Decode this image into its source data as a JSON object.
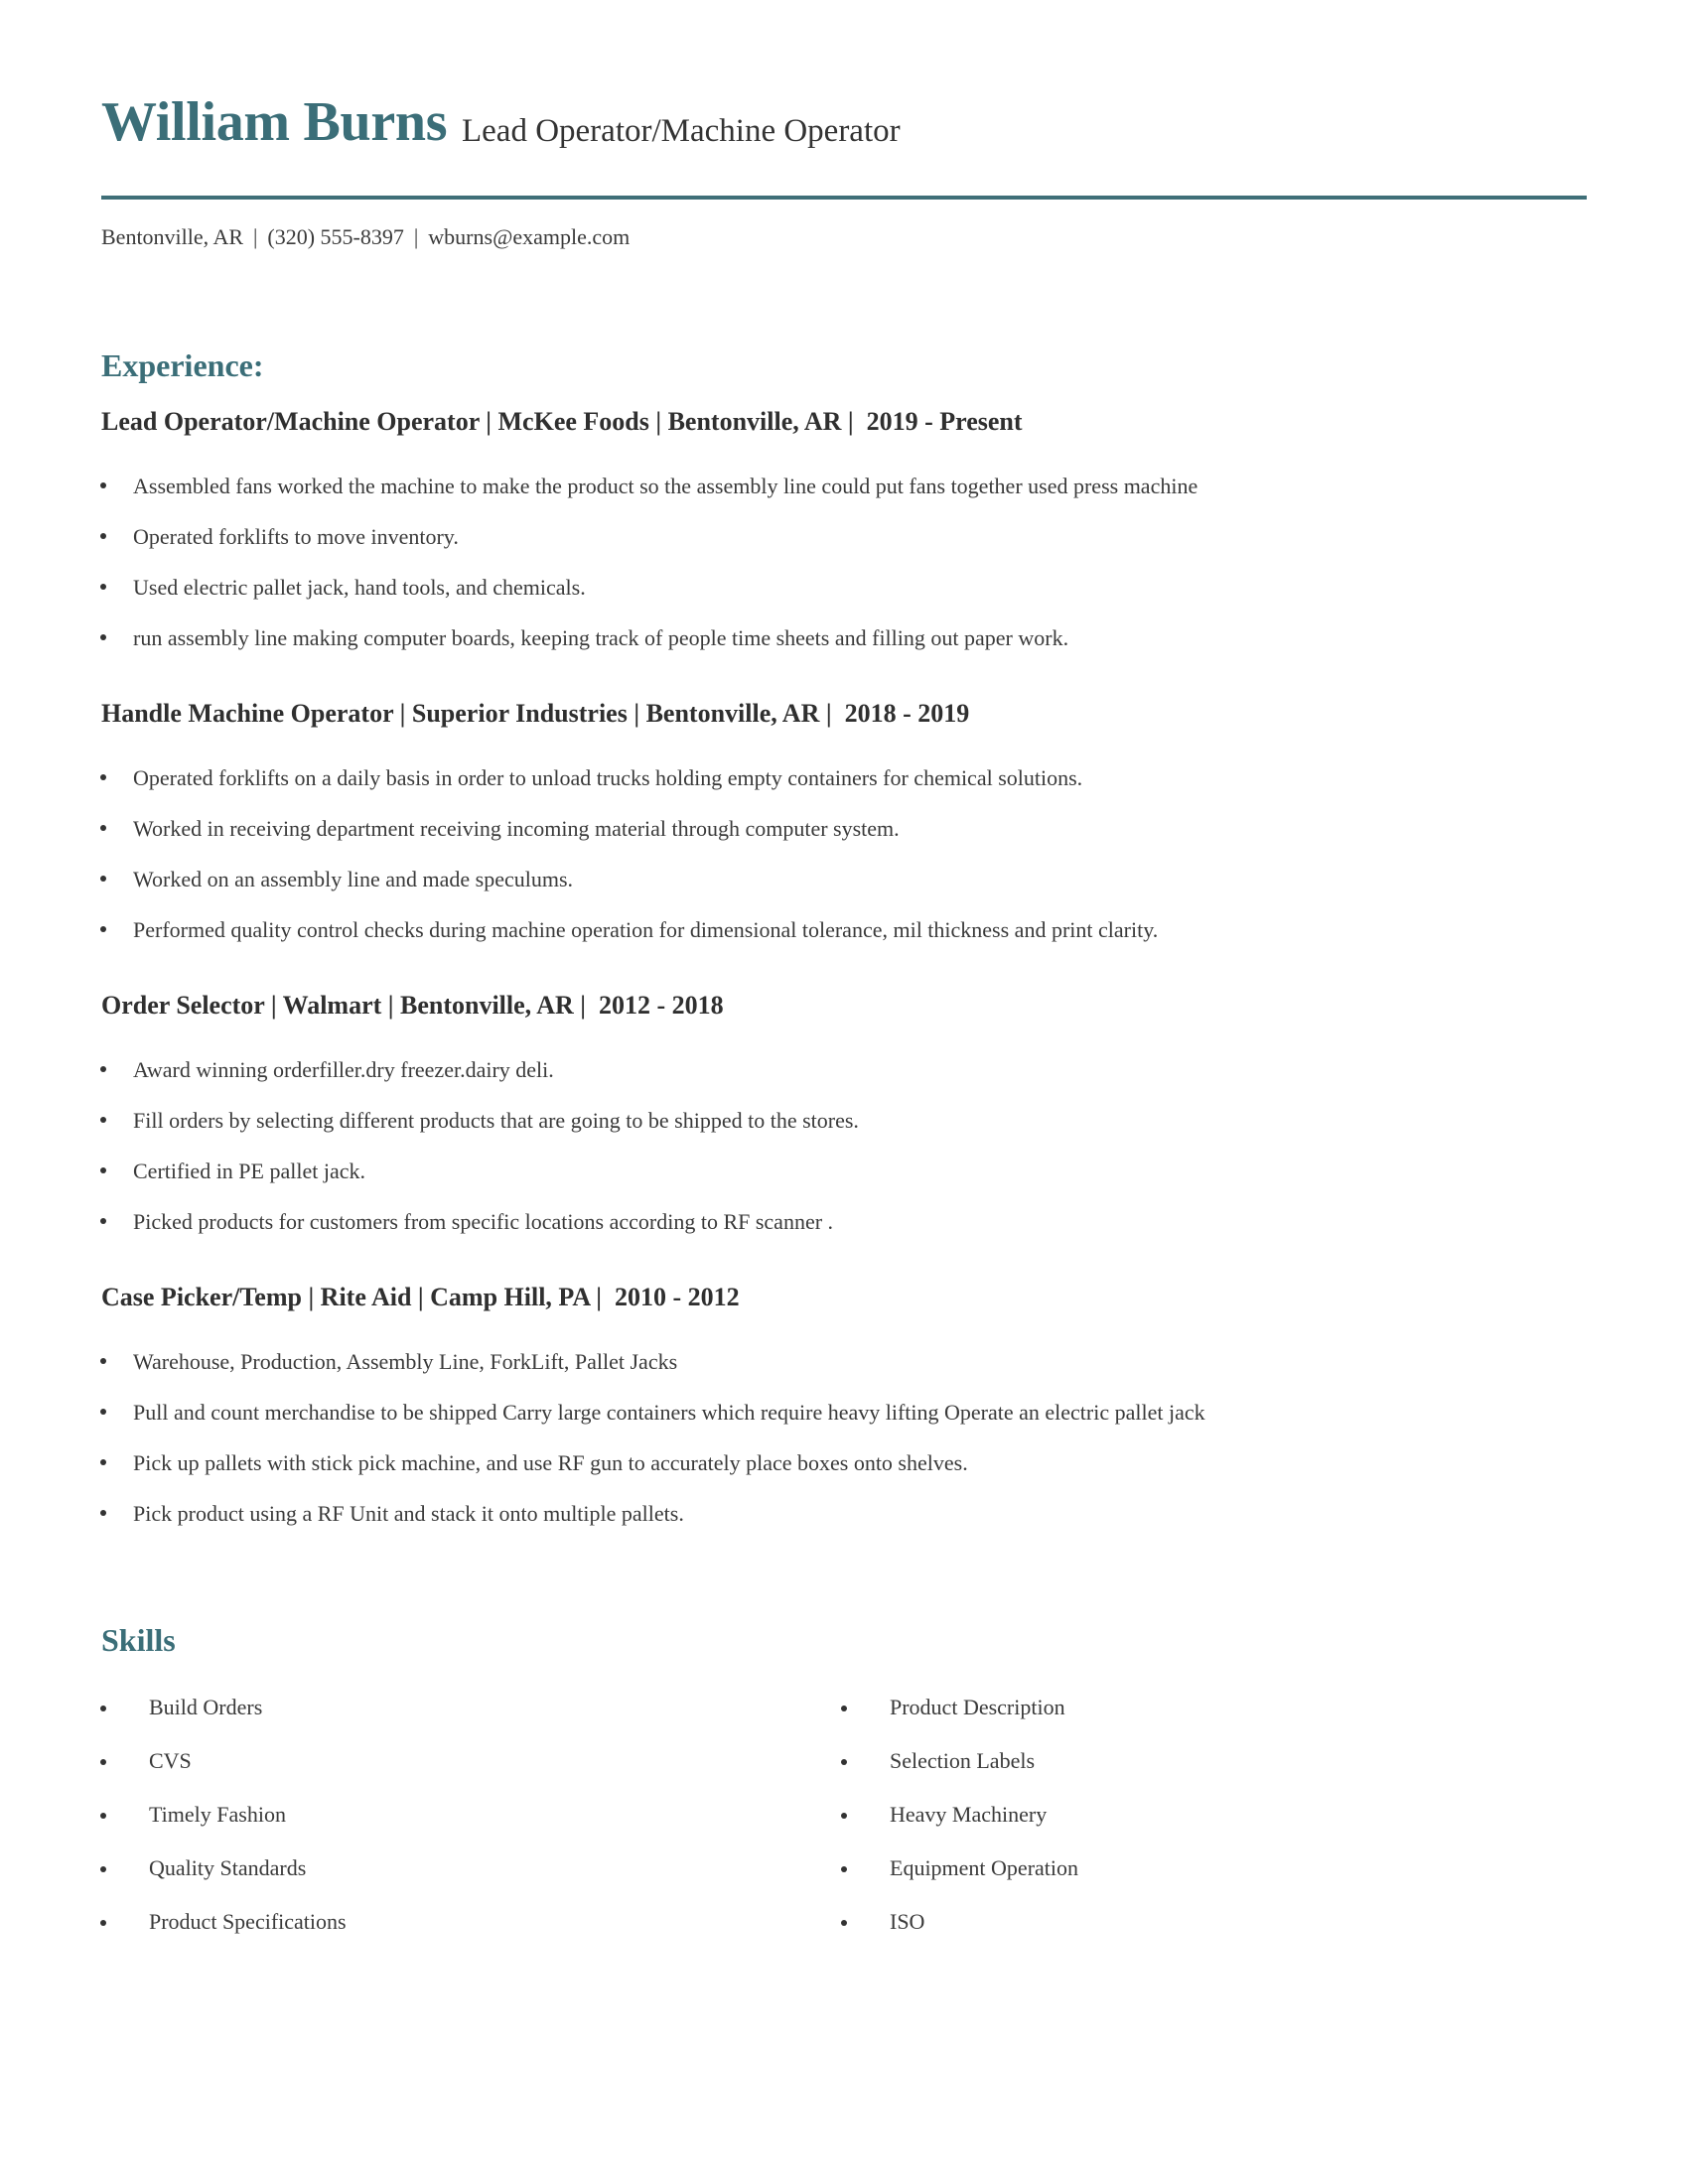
{
  "header": {
    "name": "William Burns",
    "title": "Lead Operator/Machine Operator",
    "contact": {
      "location": "Bentonville, AR",
      "phone": "(320) 555-8397",
      "email": "wburns@example.com",
      "separator": "|"
    }
  },
  "colors": {
    "accent": "#3b6e78",
    "text": "#3a3a3a"
  },
  "experience": {
    "heading": "Experience:",
    "jobs": [
      {
        "heading": "Lead Operator/Machine Operator | McKee Foods | Bentonville, AR |  2019 - Present",
        "bullets": [
          "Assembled fans worked the machine to make the product so the assembly line could put fans together used press machine",
          "Operated forklifts to move inventory.",
          "Used electric pallet jack, hand tools, and chemicals.",
          "run assembly line making computer boards, keeping track of people time sheets and filling out paper work."
        ]
      },
      {
        "heading": "Handle Machine Operator | Superior Industries | Bentonville, AR |  2018 - 2019",
        "bullets": [
          "Operated forklifts on a daily basis in order to unload trucks holding empty containers for chemical solutions.",
          "Worked in receiving department receiving incoming material through computer system.",
          "Worked on an assembly line and made speculums.",
          "Performed quality control checks during machine operation for dimensional tolerance, mil thickness and print clarity."
        ]
      },
      {
        "heading": "Order Selector | Walmart | Bentonville, AR |  2012 - 2018",
        "bullets": [
          "Award winning orderfiller.dry freezer.dairy deli.",
          "Fill orders by selecting different products that are going to be shipped to the stores.",
          "Certified in PE pallet jack.",
          "Picked products for customers from specific locations according to RF scanner ."
        ]
      },
      {
        "heading": "Case Picker/Temp | Rite Aid | Camp Hill, PA |  2010 - 2012",
        "bullets": [
          "Warehouse, Production, Assembly Line, ForkLift, Pallet Jacks",
          "Pull and count merchandise to be shipped Carry large containers which require heavy lifting Operate an electric pallet jack",
          "Pick up pallets with stick pick machine, and use RF gun to accurately place boxes onto shelves.",
          "Pick product using a RF Unit and stack it onto multiple pallets."
        ]
      }
    ]
  },
  "skills": {
    "heading": "Skills",
    "left": [
      "Build Orders",
      "CVS",
      "Timely Fashion",
      "Quality Standards",
      "Product Specifications"
    ],
    "right": [
      "Product Description",
      "Selection Labels",
      "Heavy Machinery",
      "Equipment Operation",
      "ISO"
    ]
  }
}
